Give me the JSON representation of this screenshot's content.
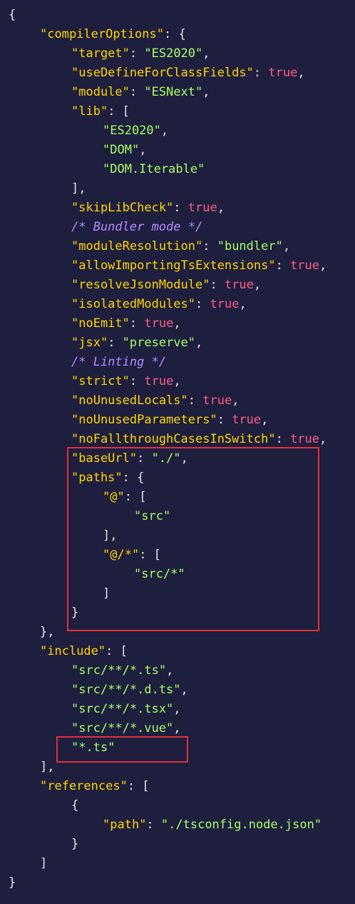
{
  "colors": {
    "background": "#1e1e3f",
    "key": "#ffd700",
    "string": "#a8ff60",
    "boolean": "#ff5c8a",
    "comment": "#b48cff",
    "punctuation": "#e6e6e6",
    "highlight": "#e0313a"
  },
  "lines": [
    {
      "indent": 0,
      "tokens": [
        {
          "t": "punc",
          "v": "{"
        }
      ]
    },
    {
      "indent": 1,
      "tokens": [
        {
          "t": "key",
          "v": "\"compilerOptions\""
        },
        {
          "t": "punc",
          "v": ": {"
        }
      ]
    },
    {
      "indent": 2,
      "tokens": [
        {
          "t": "key",
          "v": "\"target\""
        },
        {
          "t": "punc",
          "v": ": "
        },
        {
          "t": "str",
          "v": "\"ES2020\""
        },
        {
          "t": "punc",
          "v": ","
        }
      ]
    },
    {
      "indent": 2,
      "tokens": [
        {
          "t": "key",
          "v": "\"useDefineForClassFields\""
        },
        {
          "t": "punc",
          "v": ": "
        },
        {
          "t": "bool",
          "v": "true"
        },
        {
          "t": "punc",
          "v": ","
        }
      ]
    },
    {
      "indent": 2,
      "tokens": [
        {
          "t": "key",
          "v": "\"module\""
        },
        {
          "t": "punc",
          "v": ": "
        },
        {
          "t": "str",
          "v": "\"ESNext\""
        },
        {
          "t": "punc",
          "v": ","
        }
      ]
    },
    {
      "indent": 2,
      "tokens": [
        {
          "t": "key",
          "v": "\"lib\""
        },
        {
          "t": "punc",
          "v": ": ["
        }
      ]
    },
    {
      "indent": 3,
      "tokens": [
        {
          "t": "str",
          "v": "\"ES2020\""
        },
        {
          "t": "punc",
          "v": ","
        }
      ]
    },
    {
      "indent": 3,
      "tokens": [
        {
          "t": "str",
          "v": "\"DOM\""
        },
        {
          "t": "punc",
          "v": ","
        }
      ]
    },
    {
      "indent": 3,
      "tokens": [
        {
          "t": "str",
          "v": "\"DOM.Iterable\""
        }
      ]
    },
    {
      "indent": 2,
      "tokens": [
        {
          "t": "punc",
          "v": "],"
        }
      ]
    },
    {
      "indent": 2,
      "tokens": [
        {
          "t": "key",
          "v": "\"skipLibCheck\""
        },
        {
          "t": "punc",
          "v": ": "
        },
        {
          "t": "bool",
          "v": "true"
        },
        {
          "t": "punc",
          "v": ","
        }
      ]
    },
    {
      "indent": 2,
      "tokens": [
        {
          "t": "cmt",
          "v": "/* Bundler mode */"
        }
      ]
    },
    {
      "indent": 2,
      "tokens": [
        {
          "t": "key",
          "v": "\"moduleResolution\""
        },
        {
          "t": "punc",
          "v": ": "
        },
        {
          "t": "str",
          "v": "\"bundler\""
        },
        {
          "t": "punc",
          "v": ","
        }
      ]
    },
    {
      "indent": 2,
      "tokens": [
        {
          "t": "key",
          "v": "\"allowImportingTsExtensions\""
        },
        {
          "t": "punc",
          "v": ": "
        },
        {
          "t": "bool",
          "v": "true"
        },
        {
          "t": "punc",
          "v": ","
        }
      ]
    },
    {
      "indent": 2,
      "tokens": [
        {
          "t": "key",
          "v": "\"resolveJsonModule\""
        },
        {
          "t": "punc",
          "v": ": "
        },
        {
          "t": "bool",
          "v": "true"
        },
        {
          "t": "punc",
          "v": ","
        }
      ]
    },
    {
      "indent": 2,
      "tokens": [
        {
          "t": "key",
          "v": "\"isolatedModules\""
        },
        {
          "t": "punc",
          "v": ": "
        },
        {
          "t": "bool",
          "v": "true"
        },
        {
          "t": "punc",
          "v": ","
        }
      ]
    },
    {
      "indent": 2,
      "tokens": [
        {
          "t": "key",
          "v": "\"noEmit\""
        },
        {
          "t": "punc",
          "v": ": "
        },
        {
          "t": "bool",
          "v": "true"
        },
        {
          "t": "punc",
          "v": ","
        }
      ]
    },
    {
      "indent": 2,
      "tokens": [
        {
          "t": "key",
          "v": "\"jsx\""
        },
        {
          "t": "punc",
          "v": ": "
        },
        {
          "t": "str",
          "v": "\"preserve\""
        },
        {
          "t": "punc",
          "v": ","
        }
      ]
    },
    {
      "indent": 2,
      "tokens": [
        {
          "t": "cmt",
          "v": "/* Linting */"
        }
      ]
    },
    {
      "indent": 2,
      "tokens": [
        {
          "t": "key",
          "v": "\"strict\""
        },
        {
          "t": "punc",
          "v": ": "
        },
        {
          "t": "bool",
          "v": "true"
        },
        {
          "t": "punc",
          "v": ","
        }
      ]
    },
    {
      "indent": 2,
      "tokens": [
        {
          "t": "key",
          "v": "\"noUnusedLocals\""
        },
        {
          "t": "punc",
          "v": ": "
        },
        {
          "t": "bool",
          "v": "true"
        },
        {
          "t": "punc",
          "v": ","
        }
      ]
    },
    {
      "indent": 2,
      "tokens": [
        {
          "t": "key",
          "v": "\"noUnusedParameters\""
        },
        {
          "t": "punc",
          "v": ": "
        },
        {
          "t": "bool",
          "v": "true"
        },
        {
          "t": "punc",
          "v": ","
        }
      ]
    },
    {
      "indent": 2,
      "tokens": [
        {
          "t": "key",
          "v": "\"noFallthroughCasesInSwitch\""
        },
        {
          "t": "punc",
          "v": ": "
        },
        {
          "t": "bool",
          "v": "true"
        },
        {
          "t": "punc",
          "v": ","
        }
      ]
    },
    {
      "indent": 2,
      "tokens": [
        {
          "t": "key",
          "v": "\"baseUrl\""
        },
        {
          "t": "punc",
          "v": ": "
        },
        {
          "t": "str",
          "v": "\"./\""
        },
        {
          "t": "punc",
          "v": ","
        }
      ]
    },
    {
      "indent": 2,
      "tokens": [
        {
          "t": "key",
          "v": "\"paths\""
        },
        {
          "t": "punc",
          "v": ": {"
        }
      ]
    },
    {
      "indent": 3,
      "tokens": [
        {
          "t": "key",
          "v": "\"@\""
        },
        {
          "t": "punc",
          "v": ": ["
        }
      ]
    },
    {
      "indent": 4,
      "tokens": [
        {
          "t": "str",
          "v": "\"src\""
        }
      ]
    },
    {
      "indent": 3,
      "tokens": [
        {
          "t": "punc",
          "v": "],"
        }
      ]
    },
    {
      "indent": 3,
      "tokens": [
        {
          "t": "key",
          "v": "\"@/*\""
        },
        {
          "t": "punc",
          "v": ": ["
        }
      ]
    },
    {
      "indent": 4,
      "tokens": [
        {
          "t": "str",
          "v": "\"src/*\""
        }
      ]
    },
    {
      "indent": 3,
      "tokens": [
        {
          "t": "punc",
          "v": "]"
        }
      ]
    },
    {
      "indent": 2,
      "tokens": [
        {
          "t": "punc",
          "v": "}"
        }
      ]
    },
    {
      "indent": 1,
      "tokens": [
        {
          "t": "punc",
          "v": "},"
        }
      ]
    },
    {
      "indent": 1,
      "tokens": [
        {
          "t": "key",
          "v": "\"include\""
        },
        {
          "t": "punc",
          "v": ": ["
        }
      ]
    },
    {
      "indent": 2,
      "tokens": [
        {
          "t": "str",
          "v": "\"src/**/*.ts\""
        },
        {
          "t": "punc",
          "v": ","
        }
      ]
    },
    {
      "indent": 2,
      "tokens": [
        {
          "t": "str",
          "v": "\"src/**/*.d.ts\""
        },
        {
          "t": "punc",
          "v": ","
        }
      ]
    },
    {
      "indent": 2,
      "tokens": [
        {
          "t": "str",
          "v": "\"src/**/*.tsx\""
        },
        {
          "t": "punc",
          "v": ","
        }
      ]
    },
    {
      "indent": 2,
      "tokens": [
        {
          "t": "str",
          "v": "\"src/**/*.vue\""
        },
        {
          "t": "punc",
          "v": ","
        }
      ]
    },
    {
      "indent": 2,
      "tokens": [
        {
          "t": "str",
          "v": "\"*.ts\""
        }
      ]
    },
    {
      "indent": 1,
      "tokens": [
        {
          "t": "punc",
          "v": "],"
        }
      ]
    },
    {
      "indent": 1,
      "tokens": [
        {
          "t": "key",
          "v": "\"references\""
        },
        {
          "t": "punc",
          "v": ": ["
        }
      ]
    },
    {
      "indent": 2,
      "tokens": [
        {
          "t": "punc",
          "v": "{"
        }
      ]
    },
    {
      "indent": 3,
      "tokens": [
        {
          "t": "key",
          "v": "\"path\""
        },
        {
          "t": "punc",
          "v": ": "
        },
        {
          "t": "str",
          "v": "\"./tsconfig.node.json\""
        }
      ]
    },
    {
      "indent": 2,
      "tokens": [
        {
          "t": "punc",
          "v": "}"
        }
      ]
    },
    {
      "indent": 1,
      "tokens": [
        {
          "t": "punc",
          "v": "]"
        }
      ]
    },
    {
      "indent": 0,
      "tokens": [
        {
          "t": "punc",
          "v": "}"
        }
      ]
    }
  ]
}
